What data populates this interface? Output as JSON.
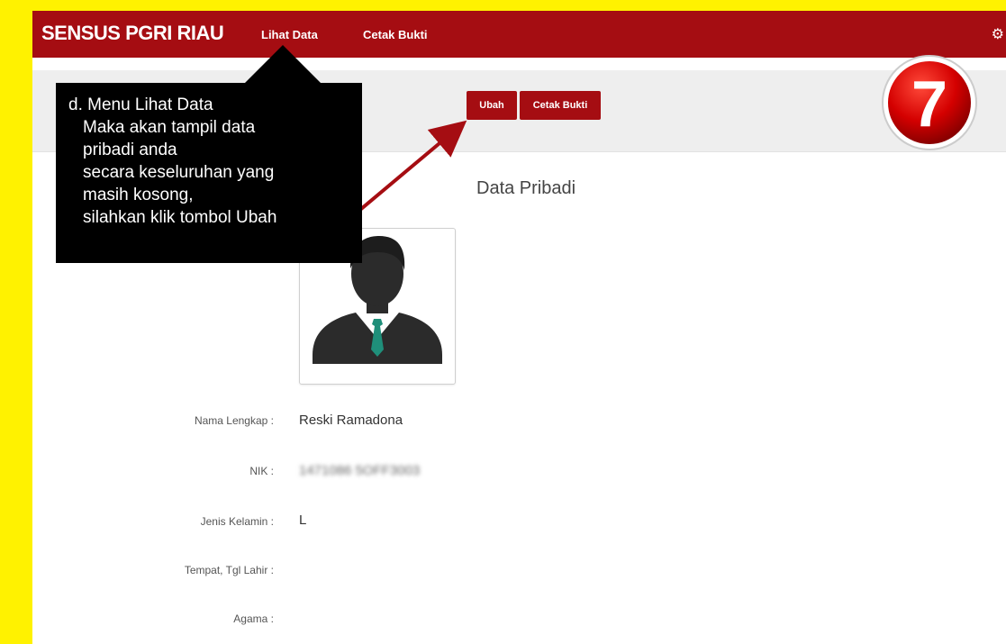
{
  "navbar": {
    "brand": "SENSUS PGRI RIAU",
    "links": [
      "Lihat Data",
      "Cetak Bukti"
    ],
    "settings_icon": "gear-icon"
  },
  "toolbar": {
    "edit_label": "Ubah",
    "print_label": "Cetak Bukti"
  },
  "section": {
    "title": "Data Pribadi",
    "avatar_icon": "user-avatar-icon"
  },
  "fields": [
    {
      "label": "Nama Lengkap :",
      "value": "Reski Ramadona"
    },
    {
      "label": "NIK :",
      "value": "1471086 5OFF3003"
    },
    {
      "label": "Jenis Kelamin :",
      "value": "L"
    },
    {
      "label": "Tempat, Tgl Lahir :",
      "value": ""
    },
    {
      "label": "Agama :",
      "value": ""
    }
  ],
  "callout": {
    "line1": "d. Menu Lihat Data",
    "line2": "Maka akan tampil data",
    "line3": "pribadi anda",
    "line4": "secara keseluruhan yang",
    "line5": "masih kosong,",
    "line6": "silahkan klik tombol Ubah"
  },
  "step_badge": "7",
  "colors": {
    "frame": "#fff200",
    "brand": "#a50d12",
    "toolbar": "#eeeeee",
    "badge": "#d40000",
    "arrow": "#a50d12"
  }
}
